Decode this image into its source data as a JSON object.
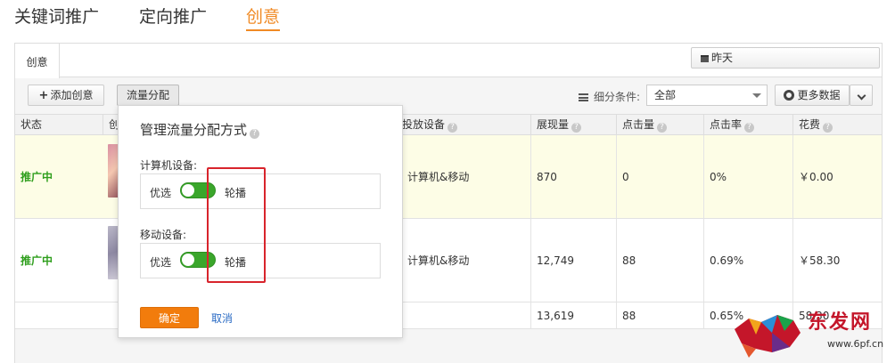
{
  "top_tabs": {
    "keyword": "关键词推广",
    "targeting": "定向推广",
    "creative": "创意"
  },
  "panel": {
    "tab_label": "创意",
    "date_label": "昨天"
  },
  "toolbar": {
    "add_label": "添加创意",
    "traffic_label": "流量分配",
    "filter_label": "细分条件:",
    "filter_value": "全部",
    "more_label": "更多数据"
  },
  "table": {
    "headers": {
      "status": "状态",
      "creative": "创",
      "device": "投放设备",
      "impressions": "展现量",
      "clicks": "点击量",
      "ctr": "点击率",
      "cost": "花费"
    },
    "rows": [
      {
        "status": "推广中",
        "device": "计算机&移动",
        "impressions": "870",
        "clicks": "0",
        "ctr": "0%",
        "cost": "￥0.00"
      },
      {
        "status": "推广中",
        "device": "计算机&移动",
        "impressions": "12,749",
        "clicks": "88",
        "ctr": "0.69%",
        "cost": "￥58.30"
      }
    ],
    "total": {
      "impressions": "13,619",
      "clicks": "88",
      "ctr": "0.65%",
      "cost": "58.30"
    }
  },
  "popup": {
    "title": "管理流量分配方式",
    "pc_label": "计算机设备:",
    "mobile_label": "移动设备:",
    "prefer": "优选",
    "rotate": "轮播",
    "ok": "确定",
    "cancel": "取消"
  },
  "watermark": {
    "text": "东发网",
    "url": "www.6pf.cn"
  },
  "colors": {
    "accent": "#f08a24",
    "status_green": "#2e9e1c",
    "toggle_green": "#3aa62b",
    "highlight_red": "#d8242c",
    "link_blue": "#2a6bc4"
  }
}
